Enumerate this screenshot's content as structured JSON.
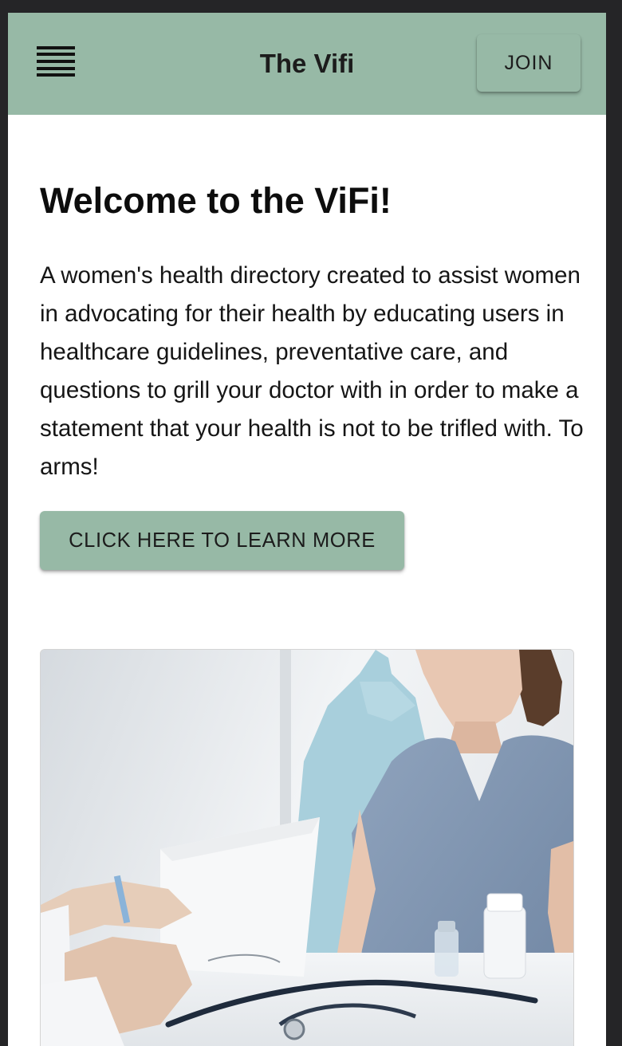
{
  "appbar": {
    "menu_icon": "hamburger-menu-icon",
    "title": "The Vifi",
    "join_label": "JOIN"
  },
  "main": {
    "heading": "Welcome to the ViFi!",
    "intro": "A women's health directory created to assist women in advocating for their health by educating users in healthcare guidelines, preventative care, and questions to grill your doctor with in order to make a statement that your health is not to be trifled with. To arms!",
    "cta_label": "CLICK HERE TO LEARN MORE"
  },
  "hero_image": {
    "alt": "Patient consultation with a doctor"
  },
  "colors": {
    "accent": "#97b9a6",
    "background": "#ffffff",
    "text": "#151515",
    "frame": "#252527"
  }
}
